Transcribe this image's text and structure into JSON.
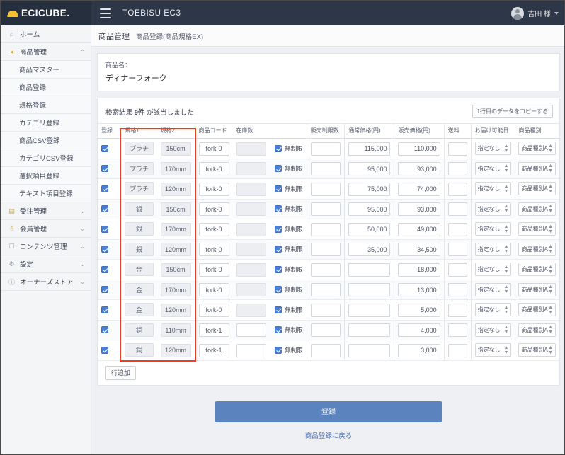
{
  "topbar": {
    "brand": "ECICUBE.",
    "site_title": "TOEBISU EC3",
    "user_name": "吉田 様",
    "menu_icon": "hamburger-icon"
  },
  "sidebar": {
    "items": [
      {
        "label": "ホーム",
        "icon": "home-icon",
        "expandable": false
      },
      {
        "label": "商品管理",
        "icon": "tag-icon",
        "expandable": true,
        "chevron": "⌃"
      },
      {
        "label": "受注管理",
        "icon": "cart-icon",
        "expandable": true,
        "chevron": "⌄"
      },
      {
        "label": "会員管理",
        "icon": "users-icon",
        "expandable": true,
        "chevron": "⌄"
      },
      {
        "label": "コンテンツ管理",
        "icon": "file-icon",
        "expandable": true,
        "chevron": "⌄"
      },
      {
        "label": "設定",
        "icon": "gear-icon",
        "expandable": true,
        "chevron": "⌄"
      },
      {
        "label": "オーナーズストア",
        "icon": "info-icon",
        "expandable": true,
        "chevron": "⌄"
      }
    ],
    "product_submenu": [
      "商品マスター",
      "商品登録",
      "規格登録",
      "カテゴリ登録",
      "商品CSV登録",
      "カテゴリCSV登録",
      "選択項目登録",
      "テキスト項目登録"
    ]
  },
  "page": {
    "breadcrumb_main": "商品管理",
    "breadcrumb_sub": "商品登録(商品規格EX)",
    "product_label": "商品名：",
    "product_name": "ディナーフォーク",
    "result_prefix": "検索結果",
    "result_count": "9件",
    "result_suffix": "が該当しました",
    "copy_first_row": "1行目のデータをコピーする",
    "add_row": "行追加",
    "submit": "登録",
    "back_link": "商品登録に戻る"
  },
  "table": {
    "headers": [
      "登録",
      "規格1",
      "規格2",
      "商品コード",
      "在庫数",
      "販売制限数",
      "通常価格(円)",
      "販売価格(円)",
      "送料",
      "お届け可能日",
      "商品種別"
    ],
    "nolimit_label": "無制限",
    "rows": [
      {
        "reg": true,
        "spec1": "プラチ",
        "spec2": "150cm",
        "code": "fork-0",
        "stock": "",
        "stock_ro": true,
        "nolimit": true,
        "limit": "",
        "price_normal": "115,000",
        "price_sale": "110,000",
        "shipping": "",
        "delivery": "指定なし",
        "ptype": "商品種別A"
      },
      {
        "reg": true,
        "spec1": "プラチ",
        "spec2": "170mm",
        "code": "fork-0",
        "stock": "",
        "stock_ro": true,
        "nolimit": true,
        "limit": "",
        "price_normal": "95,000",
        "price_sale": "93,000",
        "shipping": "",
        "delivery": "指定なし",
        "ptype": "商品種別A"
      },
      {
        "reg": true,
        "spec1": "プラチ",
        "spec2": "120mm",
        "code": "fork-0",
        "stock": "",
        "stock_ro": true,
        "nolimit": true,
        "limit": "",
        "price_normal": "75,000",
        "price_sale": "74,000",
        "shipping": "",
        "delivery": "指定なし",
        "ptype": "商品種別A"
      },
      {
        "reg": true,
        "spec1": "銀",
        "spec2": "150cm",
        "code": "fork-0",
        "stock": "",
        "stock_ro": true,
        "nolimit": true,
        "limit": "",
        "price_normal": "95,000",
        "price_sale": "93,000",
        "shipping": "",
        "delivery": "指定なし",
        "ptype": "商品種別A"
      },
      {
        "reg": true,
        "spec1": "銀",
        "spec2": "170mm",
        "code": "fork-0",
        "stock": "",
        "stock_ro": true,
        "nolimit": true,
        "limit": "",
        "price_normal": "50,000",
        "price_sale": "49,000",
        "shipping": "",
        "delivery": "指定なし",
        "ptype": "商品種別A"
      },
      {
        "reg": true,
        "spec1": "銀",
        "spec2": "120mm",
        "code": "fork-0",
        "stock": "",
        "stock_ro": true,
        "nolimit": true,
        "limit": "",
        "price_normal": "35,000",
        "price_sale": "34,500",
        "shipping": "",
        "delivery": "指定なし",
        "ptype": "商品種別A"
      },
      {
        "reg": true,
        "spec1": "金",
        "spec2": "150cm",
        "code": "fork-0",
        "stock": "",
        "stock_ro": true,
        "nolimit": true,
        "limit": "",
        "price_normal": "",
        "price_sale": "18,000",
        "shipping": "",
        "delivery": "指定なし",
        "ptype": "商品種別A"
      },
      {
        "reg": true,
        "spec1": "金",
        "spec2": "170mm",
        "code": "fork-0",
        "stock": "",
        "stock_ro": true,
        "nolimit": true,
        "limit": "",
        "price_normal": "",
        "price_sale": "13,000",
        "shipping": "",
        "delivery": "指定なし",
        "ptype": "商品種別A"
      },
      {
        "reg": true,
        "spec1": "金",
        "spec2": "120mm",
        "code": "fork-0",
        "stock": "",
        "stock_ro": true,
        "nolimit": true,
        "limit": "",
        "price_normal": "",
        "price_sale": "5,000",
        "shipping": "",
        "delivery": "指定なし",
        "ptype": "商品種別A"
      },
      {
        "reg": true,
        "spec1": "銅",
        "spec2": "110mm",
        "code": "fork-1",
        "stock": "",
        "stock_ro": false,
        "nolimit": true,
        "limit": "",
        "price_normal": "",
        "price_sale": "4,000",
        "shipping": "",
        "delivery": "指定なし",
        "ptype": "商品種別A"
      },
      {
        "reg": true,
        "spec1": "銅",
        "spec2": "120mm",
        "code": "fork-1",
        "stock": "",
        "stock_ro": false,
        "nolimit": true,
        "limit": "",
        "price_normal": "",
        "price_sale": "3,000",
        "shipping": "",
        "delivery": "指定なし",
        "ptype": "商品種別A"
      }
    ]
  },
  "colors": {
    "topbar_bg": "#2e3748",
    "brand_yellow": "#f2c230",
    "accent_blue": "#5b83bd",
    "highlight_red": "#ee3b24",
    "checkbox_blue": "#4a7fd4"
  }
}
